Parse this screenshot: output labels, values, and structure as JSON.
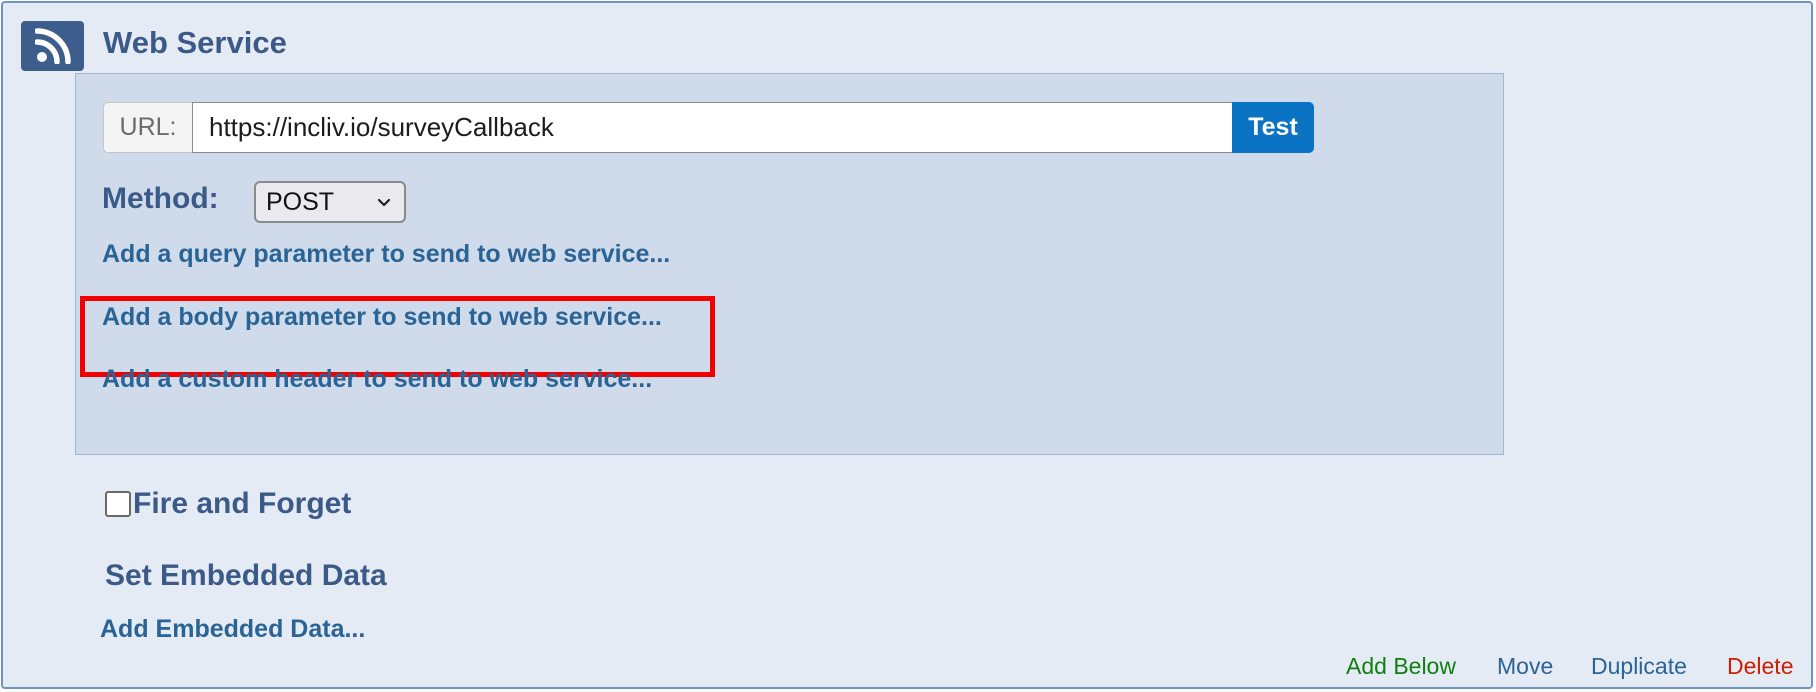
{
  "header": {
    "title": "Web Service",
    "icon": "rss-icon"
  },
  "url": {
    "label": "URL:",
    "value": "https://incliv.io/surveyCallback",
    "test_label": "Test"
  },
  "method": {
    "label": "Method:",
    "selected": "POST"
  },
  "links": {
    "query": "Add a query parameter to send to web service...",
    "body": "Add a body parameter to send to web service...",
    "header": "Add a custom header to send to web service..."
  },
  "fire_and_forget": {
    "label": "Fire and Forget",
    "checked": false
  },
  "embedded": {
    "title": "Set Embedded Data",
    "add_label": "Add Embedded Data..."
  },
  "footer": {
    "add_below": "Add Below",
    "move": "Move",
    "duplicate": "Duplicate",
    "delete": "Delete"
  },
  "colors": {
    "accent": "#0a73c4",
    "link": "#2a6396",
    "add_below": "#107e10",
    "delete": "#cc1e00",
    "highlight": "#f20000"
  }
}
